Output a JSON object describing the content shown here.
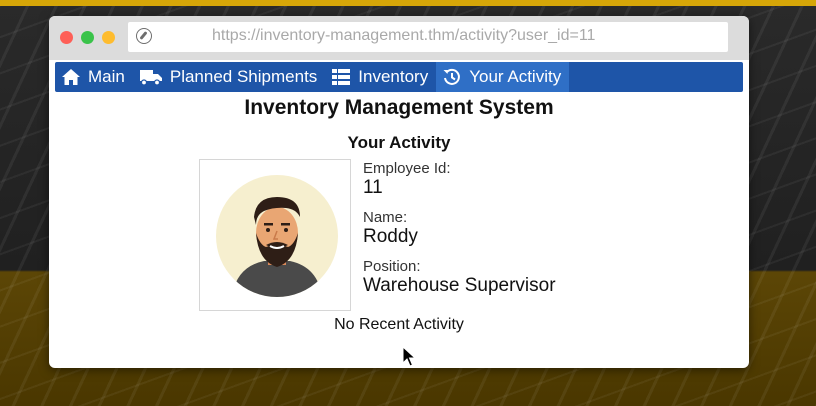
{
  "browser": {
    "url": "https://inventory-management.thm/activity?user_id=11"
  },
  "nav": {
    "items": [
      {
        "label": "Main",
        "icon": "home-icon"
      },
      {
        "label": "Planned Shipments",
        "icon": "truck-icon"
      },
      {
        "label": "Inventory",
        "icon": "list-icon"
      },
      {
        "label": "Your Activity",
        "icon": "history-icon",
        "active": true
      }
    ]
  },
  "page": {
    "app_title": "Inventory Management System",
    "section_title": "Your Activity",
    "employee_id_label": "Employee Id:",
    "employee_id": "11",
    "name_label": "Name:",
    "name": "Roddy",
    "position_label": "Position:",
    "position": "Warehouse Supervisor",
    "activity_status": "No Recent Activity"
  },
  "colors": {
    "nav_background": "#1e55a8",
    "nav_active": "#2f6fc6",
    "avatar_background": "#f6efcf"
  }
}
